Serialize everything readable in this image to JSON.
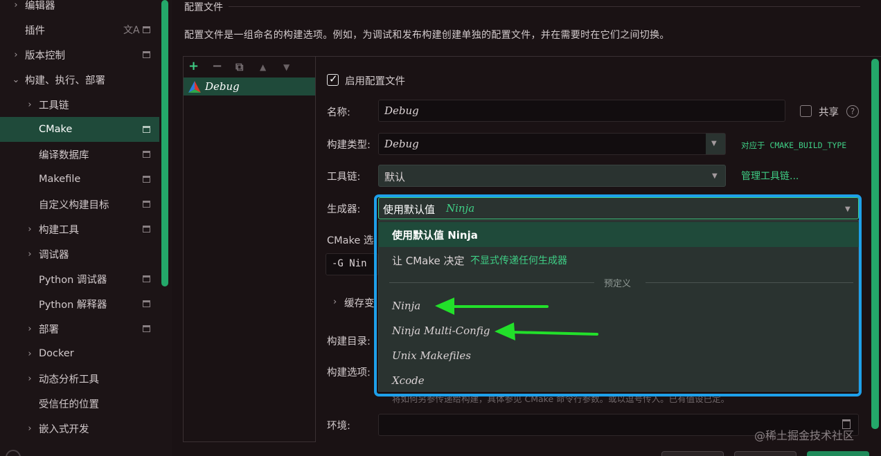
{
  "sidebar": {
    "items": [
      {
        "label": "编辑器",
        "chevron": "›"
      },
      {
        "label": "插件",
        "chevron": "",
        "translate_icon": "文A"
      },
      {
        "label": "版本控制",
        "chevron": "›"
      },
      {
        "label": "构建、执行、部署",
        "chevron": "⌄"
      },
      {
        "label": "工具链",
        "chevron": "›"
      },
      {
        "label": "CMake",
        "chevron": ""
      },
      {
        "label": "编译数据库",
        "chevron": ""
      },
      {
        "label": "Makefile",
        "chevron": ""
      },
      {
        "label": "自定义构建目标",
        "chevron": ""
      },
      {
        "label": "构建工具",
        "chevron": "›"
      },
      {
        "label": "调试器",
        "chevron": "›"
      },
      {
        "label": "Python 调试器",
        "chevron": ""
      },
      {
        "label": "Python 解释器",
        "chevron": ""
      },
      {
        "label": "部署",
        "chevron": "›"
      },
      {
        "label": "Docker",
        "chevron": "›"
      },
      {
        "label": "动态分析工具",
        "chevron": "›"
      },
      {
        "label": "受信任的位置",
        "chevron": ""
      },
      {
        "label": "嵌入式开发",
        "chevron": "›"
      }
    ]
  },
  "section_title": "配置文件",
  "description": "配置文件是一组命名的构建选项。例如，为调试和发布构建创建单独的配置文件，并在需要时在它们之间切换。",
  "profiles": {
    "toolbar": {
      "add": "+",
      "remove": "−",
      "copy": "⧉",
      "up": "▲",
      "down": "▼"
    },
    "items": [
      "Debug"
    ]
  },
  "form": {
    "enable_label": "启用配置文件",
    "name_label": "名称:",
    "name_value": "Debug",
    "share_label": "共享",
    "help_glyph": "?",
    "build_type_label": "构建类型:",
    "build_type_value": "Debug",
    "build_type_hint": "对应于 CMAKE_BUILD_TYPE",
    "toolchain_label": "工具链:",
    "toolchain_value": "默认",
    "manage_toolchains": "管理工具链...",
    "generator_label": "生成器:",
    "generator_value": "使用默认值",
    "generator_value_hint": "Ninja",
    "cmake_options_label": "CMake 选",
    "cmake_options_value": "-G Nin",
    "cache_vars_label": "缓存变",
    "build_dir_label": "构建目录:",
    "build_options_label": "构建选项:",
    "env_label": "环境:"
  },
  "dropdown": {
    "default_option": "使用默认值  Ninja",
    "let_cmake": "让 CMake 决定",
    "let_cmake_hint": "不显式传递任何生成器",
    "separator": "预定义",
    "options": [
      "Ninja",
      "Ninja Multi-Config",
      "Unix Makefiles",
      "Xcode"
    ]
  },
  "bottom_desc": "将如何另参传递给构建，具体参见 CMake 命令行参数。或以逗号传入。已有值设已定。",
  "watermark": "@稀土掘金技术社区",
  "colors": {
    "accent": "#3fcf86",
    "selection": "#1f4a3a",
    "highlight": "#1ea0ea",
    "arrow": "#22e02a"
  }
}
